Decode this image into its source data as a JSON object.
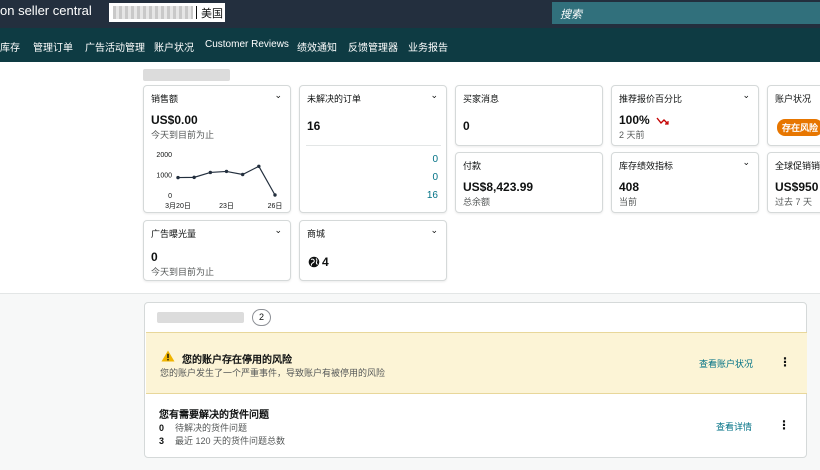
{
  "header": {
    "brand": "on seller central",
    "store_country": "美国",
    "search_placeholder": "搜索"
  },
  "nav": {
    "items": [
      "库存",
      "管理订单",
      "广告活动管理",
      "账户状况",
      "Customer Reviews",
      "绩效通知",
      "反馈管理器",
      "业务报告"
    ]
  },
  "cards": {
    "sales": {
      "title": "销售额",
      "value": "US$0.00",
      "sub": "今天到目前为止"
    },
    "open_orders": {
      "title": "未解决的订单",
      "value": "16",
      "breakdown": [
        "0",
        "0",
        "16"
      ]
    },
    "buyer_messages": {
      "title": "买家消息",
      "value": "0"
    },
    "featured_offer": {
      "title": "推荐报价百分比",
      "value": "100%",
      "sub": "2 天前"
    },
    "account_health": {
      "title": "账户状况",
      "badge": "存在风险"
    },
    "payments": {
      "title": "付款",
      "value": "US$8,423.99",
      "sub": "总余额"
    },
    "inventory_perf": {
      "title": "库存绩效指标",
      "value": "408",
      "sub": "当前"
    },
    "global_promo": {
      "title": "全球促销销售",
      "value": "US$950",
      "sub": "过去 7 天"
    },
    "ad_impressions": {
      "title": "广告曝光量",
      "value": "0",
      "sub": "今天到目前为止"
    },
    "marketplaces": {
      "title": "商城",
      "value": "4"
    }
  },
  "chart_data": {
    "type": "line",
    "x": [
      "3月20日",
      "3月21日",
      "3月22日",
      "3月23日",
      "3月24日",
      "3月25日",
      "3月26日"
    ],
    "x_tick_labels": [
      "3月20日",
      "23日",
      "26日"
    ],
    "values": [
      850,
      860,
      1100,
      1150,
      1000,
      1400,
      0
    ],
    "ylim": [
      0,
      2000
    ],
    "y_ticks": [
      "0",
      "1000",
      "2000"
    ],
    "color": "#232f3e"
  },
  "actions": {
    "count": "2",
    "warning": {
      "title": "您的账户存在停用的风险",
      "sub": "您的账户发生了一个严重事件，导致账户有被停用的风险",
      "link": "查看账户状况"
    },
    "shipment": {
      "title": "您有需要解决的货件问题",
      "lines": [
        {
          "num": "0",
          "text": "待解决的货件问题"
        },
        {
          "num": "3",
          "text": "最近 120 天的货件问题总数"
        }
      ],
      "link": "查看详情"
    }
  },
  "colors": {
    "topbar": "#232f3e",
    "navbar": "#0e3b43",
    "link": "#007185",
    "warning_bg": "#fcf4d6",
    "risk_badge": "#e77600"
  }
}
